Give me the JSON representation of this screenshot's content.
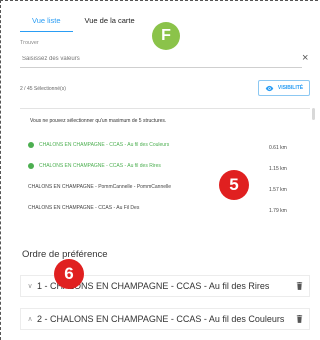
{
  "tabs": [
    {
      "label": "Vue liste",
      "active": true
    },
    {
      "label": "Vue de la carte",
      "active": false
    }
  ],
  "search": {
    "label": "Trouver",
    "placeholder": "Saisissez des valeurs"
  },
  "selected_count": "2 / 45 Sélectionné(s)",
  "visibility_button": {
    "label": "VISIBILITÉ",
    "icon": "eye-icon"
  },
  "warning": "Vous ne pouvez sélectionner qu'un maximum de 5 structures.",
  "results": [
    {
      "name": "CHALONS EN CHAMPAGNE - CCAS - Au fil des Couleurs",
      "distance": "0.61 km",
      "selected": true
    },
    {
      "name": "CHALONS EN CHAMPAGNE - CCAS - Au fil des Rires",
      "distance": "1.15 km",
      "selected": true
    },
    {
      "name": "CHALONS EN CHAMPAGNE - PommCannelle - PommCannelle",
      "distance": "1.57 km",
      "selected": false
    },
    {
      "name": "CHALONS EN CHAMPAGNE - CCAS - Au Fil Des",
      "distance": "1.79 km",
      "selected": false
    }
  ],
  "preference": {
    "title": "Ordre de préférence",
    "items": [
      {
        "label": "1 - CHALONS EN CHAMPAGNE - CCAS - Au fil des Rires",
        "chevron": "chevron-down-icon"
      },
      {
        "label": "2 - CHALONS EN CHAMPAGNE - CCAS - Au fil des Couleurs",
        "chevron": "chevron-up-icon"
      }
    ]
  },
  "badges": {
    "f": "F",
    "five": "5",
    "six": "6"
  },
  "colors": {
    "accent": "#2a9df4",
    "selected": "#4caf50",
    "badge_red": "#e02020",
    "badge_green": "#8bc34a"
  }
}
